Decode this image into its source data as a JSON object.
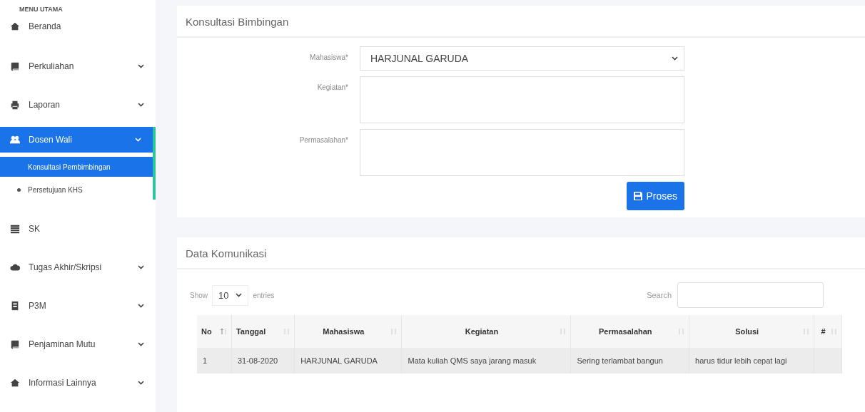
{
  "sidebar": {
    "heading": "MENU UTAMA",
    "items": [
      {
        "label": "Beranda",
        "expandable": false,
        "expanded": false,
        "selected": false
      },
      {
        "label": "Perkuliahan",
        "expandable": true,
        "expanded": false,
        "selected": false
      },
      {
        "label": "Laporan",
        "expandable": true,
        "expanded": false,
        "selected": false
      },
      {
        "label": "Dosen Wali",
        "expandable": true,
        "expanded": true,
        "selected": true,
        "children": [
          {
            "label": "Konsultasi Pembimbingan",
            "selected": true
          },
          {
            "label": "Persetujuan KHS",
            "selected": false
          }
        ]
      },
      {
        "label": "SK",
        "expandable": false,
        "expanded": false,
        "selected": false
      },
      {
        "label": "Tugas Akhir/Skripsi",
        "expandable": true,
        "expanded": false,
        "selected": false
      },
      {
        "label": "P3M",
        "expandable": true,
        "expanded": false,
        "selected": false
      },
      {
        "label": "Penjaminan Mutu",
        "expandable": true,
        "expanded": false,
        "selected": false
      },
      {
        "label": "Informasi Lainnya",
        "expandable": true,
        "expanded": false,
        "selected": false
      }
    ]
  },
  "form": {
    "title": "Konsultasi Bimbingan",
    "fields": [
      {
        "kind": "select",
        "label": "Mahasiswa*",
        "value": "HARJUNAL GARUDA"
      },
      {
        "kind": "textarea",
        "label": "Kegiatan*"
      },
      {
        "kind": "textarea",
        "label": "Permasalahan*"
      }
    ],
    "submit": "Proses"
  },
  "table_card": {
    "title": "Data Komunikasi",
    "show_label": "Show",
    "page_size": "10",
    "entries_label": "entries",
    "search_label": "Search",
    "columns": [
      {
        "label": "No",
        "sorted": true
      },
      {
        "label": "Tanggal",
        "sorted": false
      },
      {
        "label": "Mahasiswa",
        "sorted": false
      },
      {
        "label": "Kegiatan",
        "sorted": false
      },
      {
        "label": "Permasalahan",
        "sorted": false
      },
      {
        "label": "Solusi",
        "sorted": false
      },
      {
        "label": "#",
        "sorted": false
      }
    ],
    "rows": [
      [
        "1",
        "31-08-2020",
        "HARJUNAL GARUDA",
        "Mata kuliah QMS saya jarang masuk",
        "Sering terlambat bangun",
        "harus tidur lebih cepat lagi",
        ""
      ]
    ]
  }
}
